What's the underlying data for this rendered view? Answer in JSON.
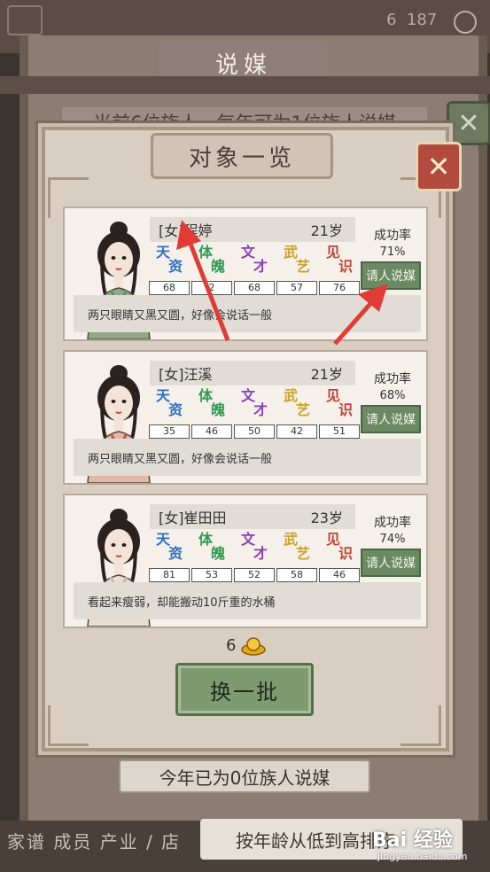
{
  "background": {
    "title": "说媒",
    "banner": "当前6位族人，每年可为1位族人说媒",
    "top_count_left": "6",
    "top_count_right": "187",
    "yearly_status": "今年已为0位族人说媒",
    "bottom_tabs": "家谱 成员 产业 / 店",
    "sort_button": "按年龄从低到高排序"
  },
  "modal": {
    "title": "对象一览",
    "refresh_cost": "6",
    "refresh_label": "换一批"
  },
  "stat_glyphs": [
    {
      "top": "天",
      "bottom": "资",
      "color": "#2f6fc2"
    },
    {
      "top": "体",
      "bottom": "魄",
      "color": "#2e9a52"
    },
    {
      "top": "文",
      "bottom": "才",
      "color": "#8a3fb5"
    },
    {
      "top": "武",
      "bottom": "艺",
      "color": "#c9a227"
    },
    {
      "top": "见",
      "bottom": "识",
      "color": "#c2413a"
    }
  ],
  "success_rate_label": "成功率",
  "ask_button_label": "请人说媒",
  "candidates": [
    {
      "name": "[女]程婷",
      "age": "21岁",
      "stats": [
        "68",
        "2",
        "68",
        "57",
        "76"
      ],
      "rate": "71%",
      "desc": "两只眼睛又黑又圆，好像会说话一般"
    },
    {
      "name": "[女]汪溪",
      "age": "21岁",
      "stats": [
        "35",
        "46",
        "50",
        "42",
        "51"
      ],
      "rate": "68%",
      "desc": "两只眼睛又黑又圆，好像会说话一般"
    },
    {
      "name": "[女]崔田田",
      "age": "23岁",
      "stats": [
        "81",
        "53",
        "52",
        "58",
        "46"
      ],
      "rate": "74%",
      "desc": "看起来瘦弱，却能搬动10斤重的水桶"
    }
  ],
  "watermark": {
    "brand": "Bai 经验",
    "url": "jingyan.baidu.com"
  },
  "colors": {
    "ask_button": "#6b8a63",
    "arrow": "#e23b36",
    "modal_bg": "#d8cfc2"
  }
}
